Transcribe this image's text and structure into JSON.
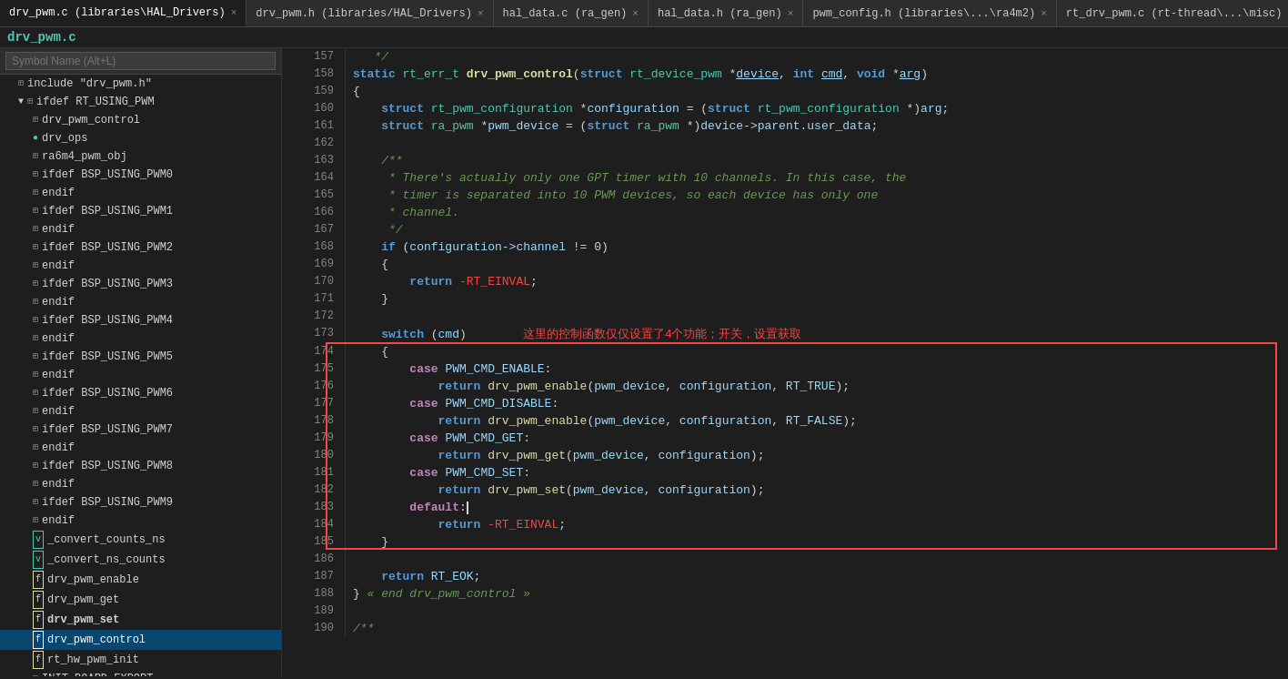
{
  "tabs": [
    {
      "label": "drv_pwm.c (libraries\\HAL_Drivers)",
      "active": true,
      "icon": "×"
    },
    {
      "label": "drv_pwm.h (libraries/HAL_Drivers)",
      "active": false,
      "icon": "×"
    },
    {
      "label": "hal_data.c (ra_gen)",
      "active": false,
      "icon": "×"
    },
    {
      "label": "hal_data.h (ra_gen)",
      "active": false,
      "icon": "×"
    },
    {
      "label": "pwm_config.h (libraries\\...\\ra4m2)",
      "active": false,
      "icon": "×"
    },
    {
      "label": "rt_drv_pwm.c (rt-thread\\...\\misc)",
      "active": false,
      "icon": "×"
    }
  ],
  "file_title": "drv_pwm.c",
  "sidebar": {
    "search_placeholder": "Symbol Name (Alt+L)",
    "items": [
      {
        "label": "include \"drv_pwm.h\"",
        "indent": 1,
        "icon": "hash",
        "type": "include"
      },
      {
        "label": "ifdef RT_USING_PWM",
        "indent": 1,
        "icon": "hash",
        "expanded": true
      },
      {
        "label": "drv_pwm_control",
        "indent": 2,
        "icon": "func"
      },
      {
        "label": "drv_ops",
        "indent": 2,
        "icon": "circle"
      },
      {
        "label": "ra6m4_pwm_obj",
        "indent": 2,
        "icon": "hash"
      },
      {
        "label": "ifdef BSP_USING_PWM0",
        "indent": 2,
        "icon": "hash"
      },
      {
        "label": "endif",
        "indent": 2,
        "icon": "hash"
      },
      {
        "label": "ifdef BSP_USING_PWM1",
        "indent": 2,
        "icon": "hash"
      },
      {
        "label": "endif",
        "indent": 2,
        "icon": "hash"
      },
      {
        "label": "ifdef BSP_USING_PWM2",
        "indent": 2,
        "icon": "hash"
      },
      {
        "label": "endif",
        "indent": 2,
        "icon": "hash"
      },
      {
        "label": "ifdef BSP_USING_PWM3",
        "indent": 2,
        "icon": "hash"
      },
      {
        "label": "endif",
        "indent": 2,
        "icon": "hash"
      },
      {
        "label": "ifdef BSP_USING_PWM4",
        "indent": 2,
        "icon": "hash"
      },
      {
        "label": "endif",
        "indent": 2,
        "icon": "hash"
      },
      {
        "label": "ifdef BSP_USING_PWM5",
        "indent": 2,
        "icon": "hash"
      },
      {
        "label": "endif",
        "indent": 2,
        "icon": "hash"
      },
      {
        "label": "ifdef BSP_USING_PWM6",
        "indent": 2,
        "icon": "hash"
      },
      {
        "label": "endif",
        "indent": 2,
        "icon": "hash"
      },
      {
        "label": "ifdef BSP_USING_PWM7",
        "indent": 2,
        "icon": "hash"
      },
      {
        "label": "endif",
        "indent": 2,
        "icon": "hash"
      },
      {
        "label": "ifdef BSP_USING_PWM8",
        "indent": 2,
        "icon": "hash"
      },
      {
        "label": "endif",
        "indent": 2,
        "icon": "hash"
      },
      {
        "label": "ifdef BSP_USING_PWM9",
        "indent": 2,
        "icon": "hash"
      },
      {
        "label": "endif",
        "indent": 2,
        "icon": "hash"
      },
      {
        "label": "_convert_counts_ns",
        "indent": 2,
        "icon": "var",
        "color": "var"
      },
      {
        "label": "_convert_ns_counts",
        "indent": 2,
        "icon": "var",
        "color": "var"
      },
      {
        "label": "drv_pwm_enable",
        "indent": 2,
        "icon": "func"
      },
      {
        "label": "drv_pwm_get",
        "indent": 2,
        "icon": "func"
      },
      {
        "label": "drv_pwm_set",
        "indent": 2,
        "icon": "func",
        "bold": true
      },
      {
        "label": "drv_pwm_control",
        "indent": 2,
        "icon": "func",
        "selected": true
      },
      {
        "label": "rt_hw_pwm_init",
        "indent": 2,
        "icon": "func"
      },
      {
        "label": "INIT_BOARD_EXPORT",
        "indent": 2,
        "icon": "hash"
      }
    ]
  },
  "code": {
    "lines": [
      {
        "num": 157,
        "content": "   */"
      },
      {
        "num": 158,
        "content": "static rt_err_t drv_pwm_control(struct rt_device_pwm *device, int cmd, void *arg)"
      },
      {
        "num": 159,
        "content": "{"
      },
      {
        "num": 160,
        "content": "    struct rt_pwm_configuration *configuration = (struct rt_pwm_configuration *)arg;"
      },
      {
        "num": 161,
        "content": "    struct ra_pwm *pwm_device = (struct ra_pwm *)device->parent.user_data;"
      },
      {
        "num": 162,
        "content": ""
      },
      {
        "num": 163,
        "content": "    /**"
      },
      {
        "num": 164,
        "content": "     * There's actually only one GPT timer with 10 channels. In this case, the"
      },
      {
        "num": 165,
        "content": "     * timer is separated into 10 PWM devices, so each device has only one"
      },
      {
        "num": 166,
        "content": "     * channel."
      },
      {
        "num": 167,
        "content": "     */"
      },
      {
        "num": 168,
        "content": "    if (configuration->channel != 0)"
      },
      {
        "num": 169,
        "content": "    {"
      },
      {
        "num": 170,
        "content": "        return -RT_EINVAL;"
      },
      {
        "num": 171,
        "content": "    }"
      },
      {
        "num": 172,
        "content": ""
      },
      {
        "num": 173,
        "content": "    switch (cmd)"
      },
      {
        "num": 174,
        "content": "    {"
      },
      {
        "num": 175,
        "content": "        case PWM_CMD_ENABLE:"
      },
      {
        "num": 176,
        "content": "            return drv_pwm_enable(pwm_device, configuration, RT_TRUE);"
      },
      {
        "num": 177,
        "content": "        case PWM_CMD_DISABLE:"
      },
      {
        "num": 178,
        "content": "            return drv_pwm_enable(pwm_device, configuration, RT_FALSE);"
      },
      {
        "num": 179,
        "content": "        case PWM_CMD_GET:"
      },
      {
        "num": 180,
        "content": "            return drv_pwm_get(pwm_device, configuration);"
      },
      {
        "num": 181,
        "content": "        case PWM_CMD_SET:"
      },
      {
        "num": 182,
        "content": "            return drv_pwm_set(pwm_device, configuration);"
      },
      {
        "num": 183,
        "content": "        default:|"
      },
      {
        "num": 184,
        "content": "            return -RT_EINVAL;"
      },
      {
        "num": 185,
        "content": "    }"
      },
      {
        "num": 186,
        "content": ""
      },
      {
        "num": 187,
        "content": "    return RT_EOK;"
      },
      {
        "num": 188,
        "content": "} « end drv_pwm_control »"
      },
      {
        "num": 189,
        "content": ""
      },
      {
        "num": 190,
        "content": "/**"
      }
    ],
    "annotation": "这里的控制函数仅仅设置了4个功能；开关，设置获取"
  }
}
